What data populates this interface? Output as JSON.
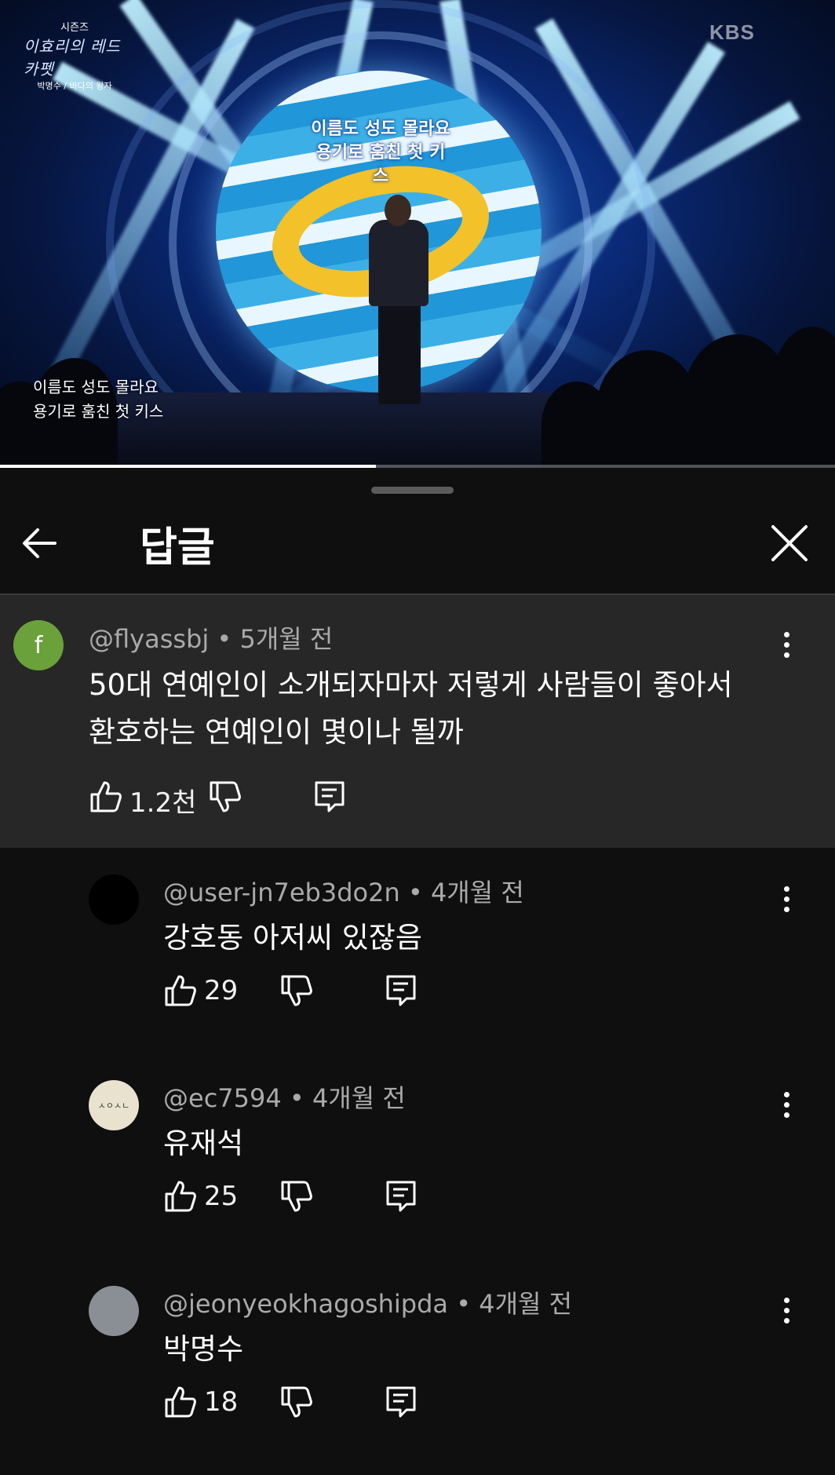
{
  "video": {
    "channel_watermark": "KBS",
    "show_logo_top": "시즌즈",
    "show_logo_main": "이효리의 레드카펫",
    "show_logo_sub": "박명수 / 바다의 왕자",
    "stage_text_line1": "이름도 성도 몰라요",
    "stage_text_line2": "용기로 훔친 첫 키스",
    "subtitle_line1": "이름도 성도 몰라요",
    "subtitle_line2": "용기로 훔친 첫 키스",
    "progress_fraction": 0.45
  },
  "panel": {
    "title": "답글",
    "back_icon": "arrow-left-icon",
    "close_icon": "close-icon"
  },
  "parent_comment": {
    "avatar_letter": "f",
    "avatar_color": "#6aa13a",
    "author": "@flyassbj",
    "time": "5개월 전",
    "text_line1": "50대 연예인이 소개되자마자 저렇게 사람들이 좋아서",
    "text_line2": "환호하는 연예인이 몇이나 될까",
    "likes": "1.2천"
  },
  "replies": [
    {
      "author": "@user-jn7eb3do2n",
      "time": "4개월 전",
      "text": "강호동 아저씨 있잖음",
      "likes": "29",
      "avatar_color": "#000000"
    },
    {
      "author": "@ec7594",
      "time": "4개월 전",
      "text": "유재석",
      "likes": "25",
      "avatar_color": "#e9e2cf",
      "avatar_label": "ㅅㅇㅅㄴ"
    },
    {
      "author": "@jeonyeokhagoshipda",
      "time": "4개월 전",
      "text": "박명수",
      "likes": "18",
      "avatar_color": "#8a8f96"
    }
  ],
  "separator": " • "
}
